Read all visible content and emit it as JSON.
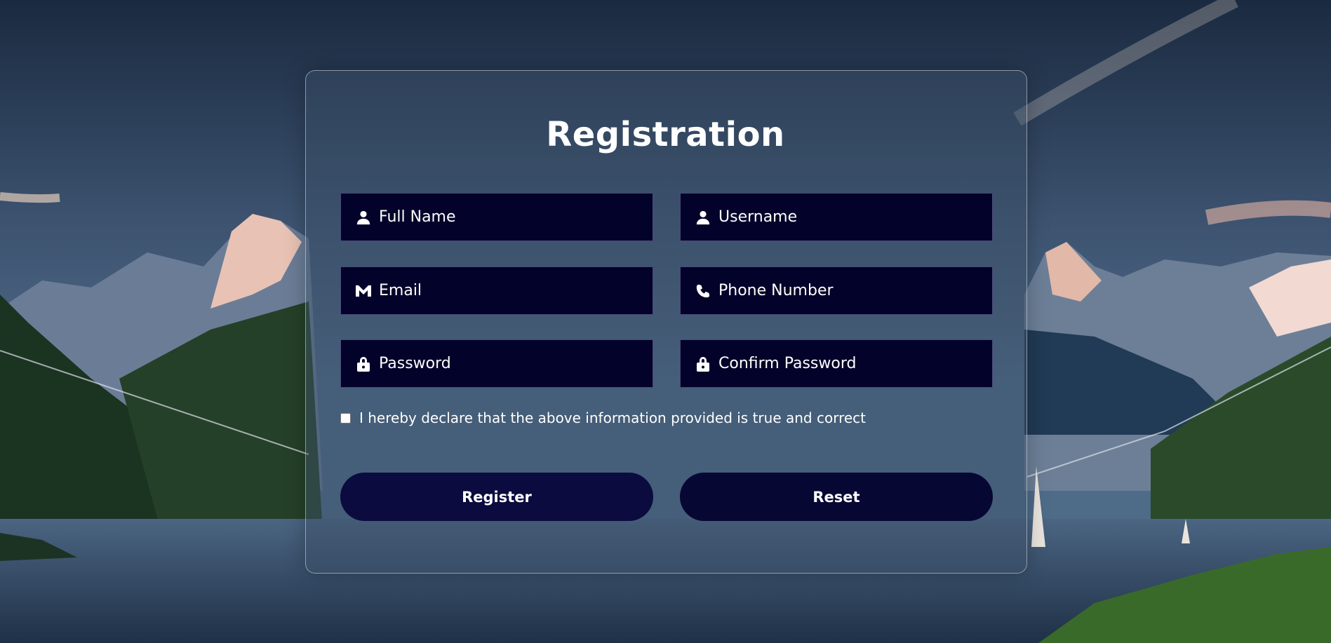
{
  "form": {
    "title": "Registration",
    "fields": [
      {
        "placeholder": "Full Name",
        "icon": "user-icon"
      },
      {
        "placeholder": "Username",
        "icon": "user-icon"
      },
      {
        "placeholder": "Email",
        "icon": "mail-icon"
      },
      {
        "placeholder": "Phone Number",
        "icon": "phone-icon"
      },
      {
        "placeholder": "Password",
        "icon": "lock-icon"
      },
      {
        "placeholder": "Confirm Password",
        "icon": "lock-icon"
      }
    ],
    "declaration": "I hereby declare that the above information provided is true and correct",
    "register_label": "Register",
    "reset_label": "Reset"
  },
  "colors": {
    "field_bg": "#03022a",
    "button_bg": "#0b0b3f",
    "text": "#ffffff"
  }
}
